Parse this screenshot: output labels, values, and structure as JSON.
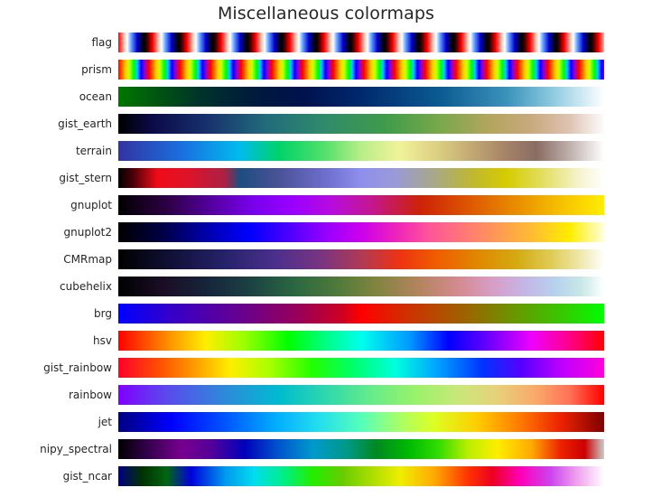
{
  "figure": {
    "title": "Miscellaneous colormaps",
    "title_color": "#262626",
    "background_color": "#ffffff",
    "label_color": "#262626"
  },
  "chart_data": {
    "type": "heatmap",
    "title": "Miscellaneous colormaps",
    "xlabel": "",
    "ylabel": "",
    "legend_position": "none",
    "grid": false,
    "x": [
      0.0,
      1.0
    ],
    "description": "Matplotlib colormap reference: 17 horizontal colorbars, each showing a named colormap ramped from 0 to 1 left to right, labeled at the left.",
    "categories": [
      "flag",
      "prism",
      "ocean",
      "gist_earth",
      "terrain",
      "gist_stern",
      "gnuplot",
      "gnuplot2",
      "CMRmap",
      "cubehelix",
      "brg",
      "hsv",
      "gist_rainbow",
      "rainbow",
      "jet",
      "nipy_spectral",
      "gist_ncar"
    ],
    "series": [
      {
        "name": "flag",
        "gradient": "repeating-linear-gradient(to right, #ff0000 0px, #ffd0c0 7px, #ffffff 10px, #6aa8ff 14px, #0000cc 21px, #000033 26px, #000000 29px, #3b0000 32px, #ff0000 38px)"
      },
      {
        "name": "prism",
        "gradient": "repeating-linear-gradient(to right, #ff0000 0px, #ff6600 4px, #ffcc00 8px, #ccff00 12px, #00ff00 17px, #00ccff 21px, #0000ff 25px, #8800dd 29px, #ff0000 34px)"
      },
      {
        "name": "ocean",
        "gradient": "linear-gradient(to right, #007700 0%, #005511 8%, #00332b 17%, #001a3d 28%, #00114d 38%, #00296e 50%, #0b5a92 66%, #3a93bb 80%, #94cde3 90%, #ffffff 100%)"
      },
      {
        "name": "gist_earth",
        "gradient": "linear-gradient(to right, #000000 0%, #0b0a49 7%, #17306d 18%, #216a7c 30%, #2f8a6c 42%, #3f9b4a 55%, #78a84a 66%, #b2a55d 76%, #c9a97e 85%, #dfc4b4 93%, #fdfdfd 100%)"
      },
      {
        "name": "terrain",
        "gradient": "linear-gradient(to right, #3333a0 0%, #1a6fe0 13%, #00bbee 25%, #00d26a 33%, #4de06a 42%, #b8ee88 50%, #f2f29a 58%, #d8c87e 67%, #a98668 79%, #8a6c63 86%, #bfb1ae 93%, #ffffff 100%)"
      },
      {
        "name": "gist_stern",
        "gradient": "linear-gradient(to right, #000000 0%, #4a0008 3%, #ee0c17 8%, #e01229 14%, #aa2145 22%, #1d4d80 25%, #4b5296 33%, #6f6fd0 43%, #8f8fee 50%, #9a9ad8 57%, #a8a888 65%, #c0b830 73%, #d6cc00 80%, #e4e06a 88%, #f6f4cf 95%, #ffffff 100%)"
      },
      {
        "name": "gnuplot",
        "gradient": "linear-gradient(to right, #000000 0%, #2d0044 10%, #5800a8 20%, #7a00ee 28%, #9a00ff 36%, #b80cdd 44%, #c41690 52%, #cc2208 62%, #dd5500 72%, #e88800 81%, #f5bb00 90%, #ffee00 100%)"
      },
      {
        "name": "gnuplot2",
        "gradient": "linear-gradient(to right, #000000 0%, #000044 9%, #0000aa 18%, #0000ff 27%, #5500ff 36%, #9900ff 43%, #cc00ee 50%, #ee22bb 57%, #ff5599 64%, #ff7777 71%, #ff9955 78%, #ffbb33 85%, #ffee00 93%, #ffffdd 100%)"
      },
      {
        "name": "CMRmap",
        "gradient": "linear-gradient(to right, #000000 0%, #0f0f33 10%, #26226b 22%, #4a2f8c 32%, #7a3580 42%, #b03a55 50%, #ee3311 58%, #f05a00 65%, #e08800 74%, #d4aa11 82%, #dfcb55 89%, #f0e7aa 95%, #ffffff 100%)"
      },
      {
        "name": "cubehelix",
        "gradient": "linear-gradient(to right, #000000 0%, #1a0d24 9%, #16243a 18%, #1b4142 27%, #2a6642 36%, #4f7a3a 45%, #81843f 53%, #b4845f 62%, #d48a90 70%, #d79ec6 77%, #c4b7e6 84%, #b6d2ee 90%, #c6e6e6 95%, #ffffff 100%)"
      },
      {
        "name": "brg",
        "gradient": "linear-gradient(to right, #0000ff 0%, #3a00c4 12%, #66008f 25%, #99005a 37%, #cc0022 46%, #ff0000 50%, #cc3300 60%, #9a6600 72%, #669900 82%, #33cc00 92%, #00ff00 100%)"
      },
      {
        "name": "hsv",
        "gradient": "linear-gradient(to right, #ff0000 0%, #ff9900 11%, #ffee00 18%, #99ff00 26%, #00ff00 35%, #00ff88 43%, #00ffee 50%, #0099ff 60%, #0000ff 68%, #7700ff 77%, #ee00ff 85%, #ff0088 93%, #ff0000 100%)"
      },
      {
        "name": "gist_rainbow",
        "gradient": "linear-gradient(to right, #ff0029 0%, #ff5500 9%, #ffaa00 17%, #ffee00 23%, #aaff00 31%, #22ff00 40%, #00ff66 48%, #00ffdd 57%, #00aaff 65%, #0033ff 75%, #5500ff 83%, #bb00ff 91%, #ff00dd 100%)"
      },
      {
        "name": "rainbow",
        "gradient": "linear-gradient(to right, #8000ff 0%, #5a4aee 10%, #2d8ada 22%, #00bbd0 33%, #2fd9ab 43%, #66eb8a 52%, #99f26a 61%, #c9e87a 70%, #e8d07a 78%, #f9a96a 86%, #ff7055 93%, #ff0000 100%)"
      },
      {
        "name": "jet",
        "gradient": "linear-gradient(to right, #00007f 0%, #0000ff 11%, #0055ff 22%, #00aaff 32%, #22ddee 41%, #55ffbb 50%, #aaff66 58%, #ddff22 65%, #ffcc00 74%, #ff7700 83%, #ee2200 91%, #7f0000 100%)"
      },
      {
        "name": "nipy_spectral",
        "gradient": "linear-gradient(to right, #000000 0%, #33004d 6%, #77008f 13%, #550099 19%, #0000bb 26%, #0055cc 33%, #0099cc 40%, #009988 47%, #008822 53%, #00bb00 60%, #33dd00 66%, #bbee00 72%, #ffee00 78%, #ffaa00 85%, #ee2200 91%, #cc0000 96%, #cccccc 100%)"
      },
      {
        "name": "gist_ncar",
        "gradient": "linear-gradient(to right, #000080 0%, #003300 5%, #006611 10%, #0000dd 15%, #0099ee 22%, #00ddee 28%, #00ee88 34%, #22ee00 40%, #66cc00 46%, #aadd00 52%, #eeee00 58%, #ffaa00 65%, #ff3300 72%, #ee0022 77%, #ff00bb 83%, #cc44ee 89%, #ee99ee 94%, #ffffff 100%)"
      }
    ]
  }
}
